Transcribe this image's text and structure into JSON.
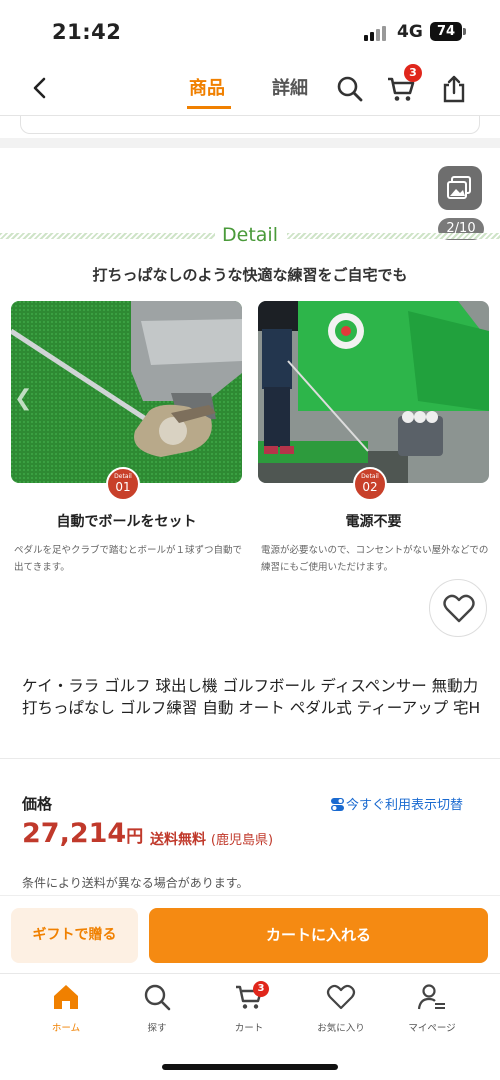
{
  "status": {
    "time": "21:42",
    "network": "4G",
    "battery": "74"
  },
  "header": {
    "tabs": [
      {
        "label": "商品",
        "active": true
      },
      {
        "label": "詳細",
        "active": false
      }
    ],
    "cart_count": "3"
  },
  "gallery": {
    "counter": "2/10",
    "detail_word": "Detail",
    "headline": "打ちっぱなしのような快適な練習をご自宅でも"
  },
  "features": [
    {
      "badge_small": "Detail",
      "badge_num": "01",
      "title": "自動でボールをセット",
      "desc": "ペダルを足やクラブで踏むとボールが１球ずつ自動で出てきます。"
    },
    {
      "badge_small": "Detail",
      "badge_num": "02",
      "title": "電源不要",
      "desc": "電源が必要ないので、コンセントがない屋外などでの練習にもご使用いただけます。"
    }
  ],
  "product": {
    "name": "ケイ・ララ ゴルフ 球出し機 ゴルフボール ディスペンサー 無動力 打ちっぱなし ゴルフ練習 自動 オート ペダル式 ティーアップ 宅H"
  },
  "pricing": {
    "label": "価格",
    "switch_link": "今すぐ利用表示切替",
    "price": "27,214",
    "unit": "円",
    "shipping": "送料無料",
    "shipping_region": "(鹿児島県)",
    "note": "条件により送料が異なる場合があります。"
  },
  "actions": {
    "gift": "ギフトで贈る",
    "add_to_cart": "カートに入れる"
  },
  "tabbar": {
    "items": [
      {
        "label": "ホーム",
        "icon": "home-icon"
      },
      {
        "label": "探す",
        "icon": "search-icon"
      },
      {
        "label": "カート",
        "icon": "cart-icon"
      },
      {
        "label": "お気に入り",
        "icon": "heart-icon"
      },
      {
        "label": "マイページ",
        "icon": "user-icon"
      }
    ],
    "cart_count": "3"
  },
  "colors": {
    "accent": "#f08000",
    "price": "#c0392b",
    "link": "#1a6ad0",
    "badge": "#e0261b"
  }
}
